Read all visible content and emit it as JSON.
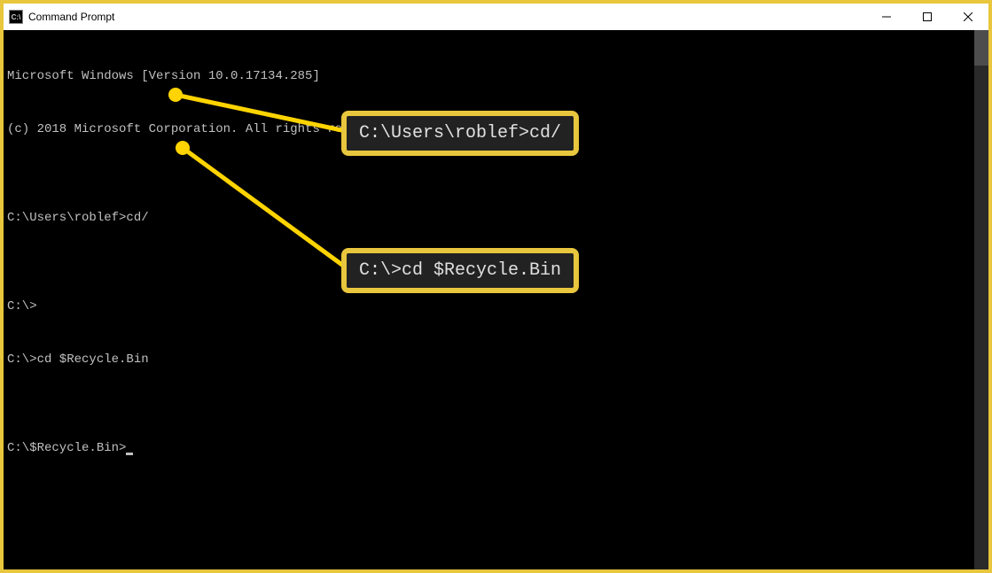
{
  "titlebar": {
    "icon_label": "C:\\",
    "title": "Command Prompt"
  },
  "terminal": {
    "lines": [
      "Microsoft Windows [Version 10.0.17134.285]",
      "(c) 2018 Microsoft Corporation. All rights reserved.",
      "",
      "C:\\Users\\roblef>cd/",
      "",
      "C:\\>",
      "C:\\>cd $Recycle.Bin",
      "",
      "C:\\$Recycle.Bin>"
    ]
  },
  "callouts": {
    "box1": "C:\\Users\\roblef>cd/",
    "box2": "C:\\>cd $Recycle.Bin"
  },
  "colors": {
    "accent": "#e8c63d",
    "dot": "#ffd400",
    "terminal_bg": "#000000",
    "terminal_fg": "#c0c0c0"
  }
}
